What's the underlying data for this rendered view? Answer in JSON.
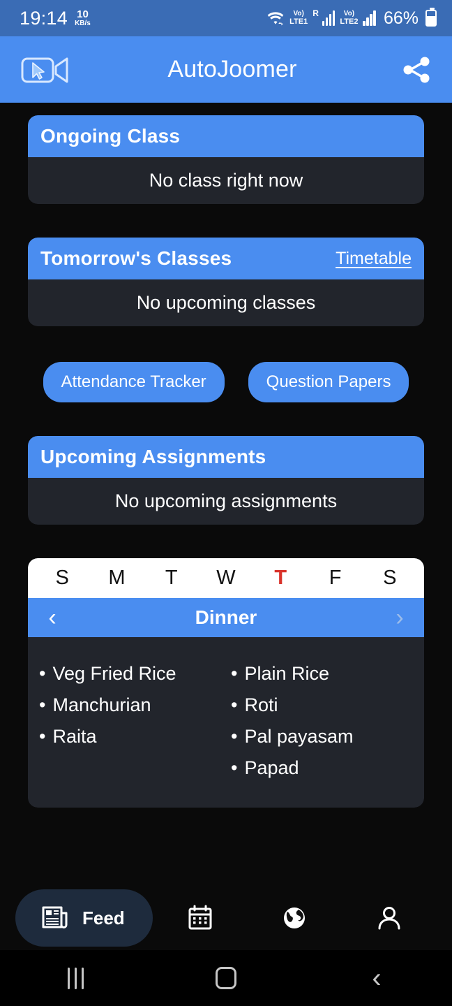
{
  "status_bar": {
    "time": "19:14",
    "net_speed_value": "10",
    "net_speed_unit": "KB/s",
    "wifi_icon": "wifi-icon",
    "sim1_volte_label": "Vo)",
    "sim1_network": "LTE1",
    "roaming_indicator": "R",
    "sim2_volte_label": "Vo)",
    "sim2_network": "LTE2",
    "battery_percent": "66%",
    "background_color": "#3a6cb5"
  },
  "app_bar": {
    "title": "AutoJoomer",
    "logo_icon": "video-camera-cursor-icon",
    "share_icon": "share-icon",
    "background_color": "#4a8df0"
  },
  "cards": {
    "ongoing": {
      "title": "Ongoing Class",
      "body": "No class right now"
    },
    "tomorrow": {
      "title": "Tomorrow's Classes",
      "link": "Timetable",
      "body": "No upcoming classes"
    },
    "assignments": {
      "title": "Upcoming Assignments",
      "body": "No upcoming assignments"
    }
  },
  "quick_actions": [
    {
      "label": "Attendance Tracker"
    },
    {
      "label": "Question Papers"
    }
  ],
  "menu_card": {
    "days": [
      {
        "letter": "S",
        "today": false
      },
      {
        "letter": "M",
        "today": false
      },
      {
        "letter": "T",
        "today": false
      },
      {
        "letter": "W",
        "today": false
      },
      {
        "letter": "T",
        "today": true
      },
      {
        "letter": "F",
        "today": false
      },
      {
        "letter": "S",
        "today": false
      }
    ],
    "today_color": "#d9332b",
    "meal": "Dinner",
    "prev_icon": "chevron-left-icon",
    "next_icon": "chevron-right-icon",
    "items_left": [
      "Veg Fried Rice",
      "Manchurian",
      "Raita"
    ],
    "items_right": [
      "Plain Rice",
      "Roti",
      "Pal payasam",
      "Papad"
    ],
    "bullet": "•"
  },
  "bottom_nav": {
    "active_label": "Feed",
    "active_icon": "newspaper-icon",
    "active_pill_color": "#1e2b3d",
    "items": [
      {
        "icon": "calendar-icon"
      },
      {
        "icon": "globe-icon"
      },
      {
        "icon": "person-icon"
      }
    ]
  },
  "android_nav": {
    "recents_icon": "recents-icon",
    "home_icon": "home-icon",
    "back_icon": "back-icon"
  }
}
